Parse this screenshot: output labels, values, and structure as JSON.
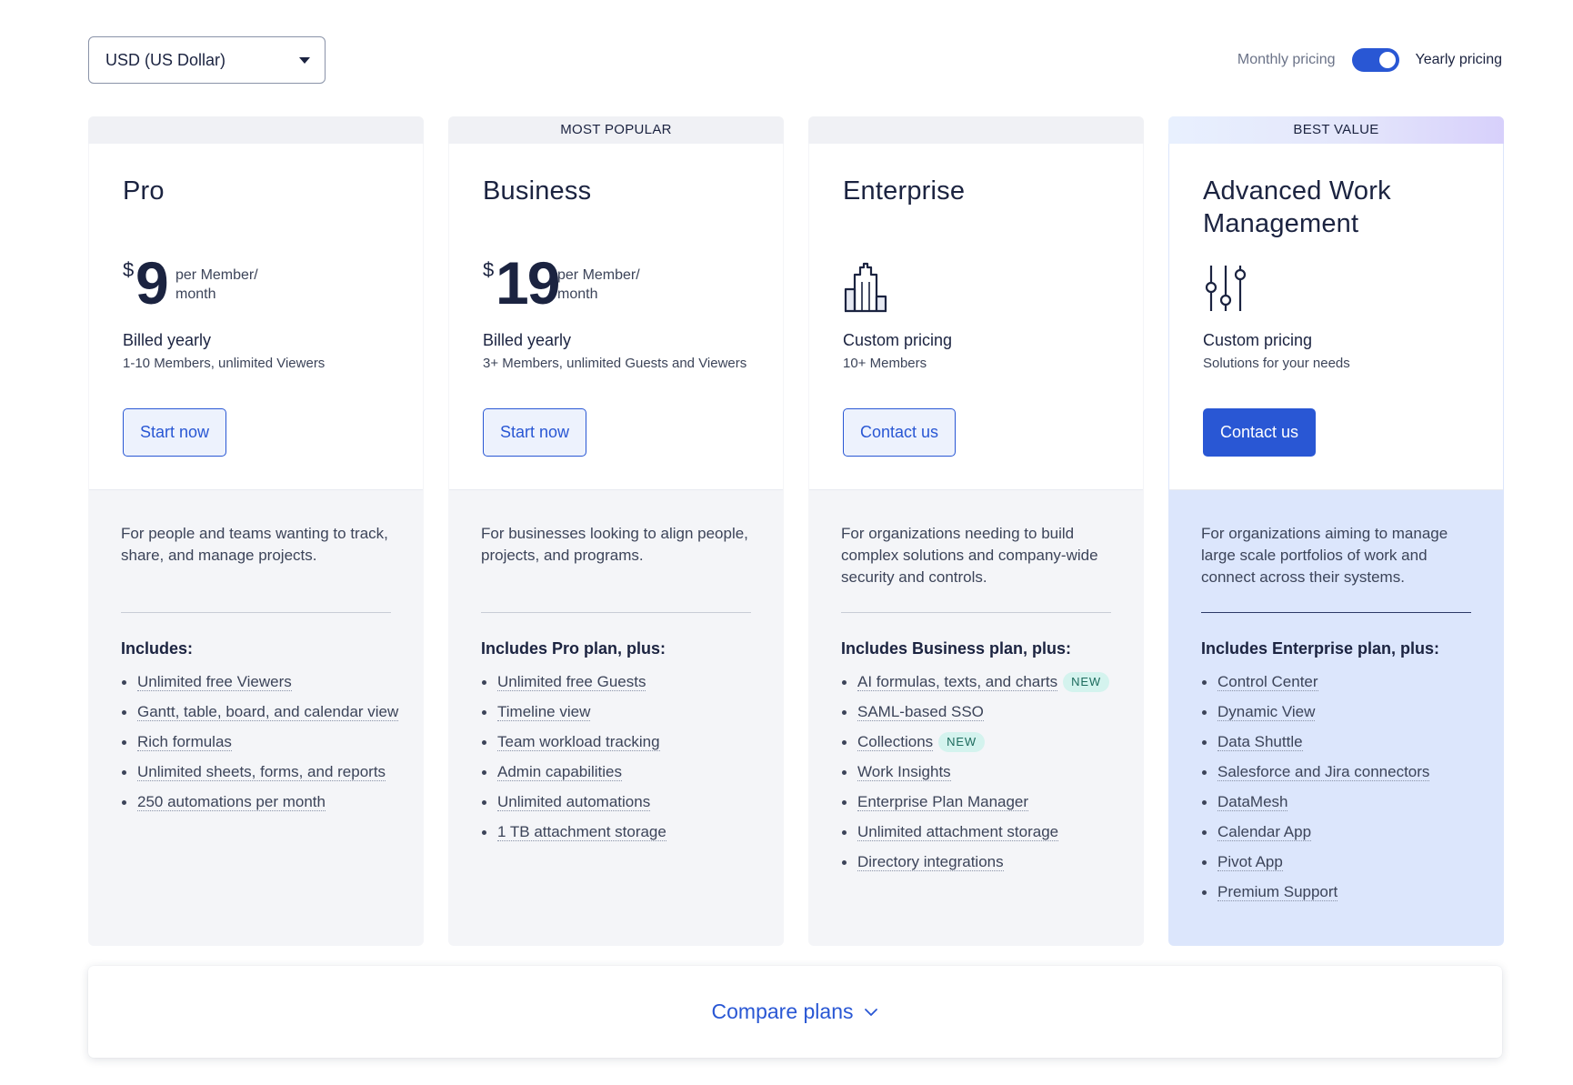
{
  "currency": {
    "selected": "USD (US Dollar)"
  },
  "toggle": {
    "monthly_label": "Monthly pricing",
    "yearly_label": "Yearly pricing",
    "selected": "yearly"
  },
  "plans": [
    {
      "banner": "",
      "name": "Pro",
      "price_currency": "$",
      "price_amount": "9",
      "price_per_line1": "per Member/",
      "price_per_line2": "month",
      "billing_title": "Billed yearly",
      "billing_sub": "1-10 Members, unlimited Viewers",
      "cta": "Start now",
      "description": "For people and teams wanting to track, share, and manage projects.",
      "includes_title": "Includes:",
      "features": [
        {
          "text": "Unlimited free Viewers"
        },
        {
          "text": "Gantt, table, board, and calendar view"
        },
        {
          "text": "Rich formulas"
        },
        {
          "text": "Unlimited sheets, forms, and reports"
        },
        {
          "text": "250 automations per month"
        }
      ]
    },
    {
      "banner": "MOST POPULAR",
      "name": "Business",
      "price_currency": "$",
      "price_amount": "19",
      "price_per_line1": "per Member/",
      "price_per_line2": "month",
      "billing_title": "Billed yearly",
      "billing_sub": "3+ Members, unlimited Guests and Viewers",
      "cta": "Start now",
      "description": "For businesses looking to align people, projects, and programs.",
      "includes_title": "Includes Pro plan, plus:",
      "features": [
        {
          "text": "Unlimited free Guests"
        },
        {
          "text": "Timeline view"
        },
        {
          "text": "Team workload tracking"
        },
        {
          "text": "Admin capabilities"
        },
        {
          "text": "Unlimited automations"
        },
        {
          "text": "1 TB attachment storage"
        }
      ]
    },
    {
      "banner": "",
      "name": "Enterprise",
      "icon": "building-icon",
      "billing_title": "Custom pricing",
      "billing_sub": "10+ Members",
      "cta": "Contact us",
      "description": "For organizations needing to build complex solutions and company-wide security and controls.",
      "includes_title": "Includes Business plan, plus:",
      "features": [
        {
          "text": "AI formulas, texts, and charts",
          "badge": "NEW"
        },
        {
          "text": "SAML-based SSO"
        },
        {
          "text": "Collections",
          "badge": "NEW"
        },
        {
          "text": "Work Insights"
        },
        {
          "text": "Enterprise Plan Manager"
        },
        {
          "text": "Unlimited attachment storage"
        },
        {
          "text": "Directory integrations"
        }
      ]
    },
    {
      "banner": "BEST VALUE",
      "name": "Advanced Work Management",
      "icon": "sliders-icon",
      "billing_title": "Custom pricing",
      "billing_sub": "Solutions for your needs",
      "cta": "Contact us",
      "description": "For organizations aiming to manage large scale portfolios of work and connect across their systems.",
      "includes_title": "Includes Enterprise plan, plus:",
      "features": [
        {
          "text": "Control Center"
        },
        {
          "text": "Dynamic View"
        },
        {
          "text": "Data Shuttle"
        },
        {
          "text": "Salesforce and Jira connectors"
        },
        {
          "text": "DataMesh"
        },
        {
          "text": "Calendar App"
        },
        {
          "text": "Pivot App"
        },
        {
          "text": "Premium Support"
        }
      ]
    }
  ],
  "compare": {
    "label": "Compare plans"
  },
  "colors": {
    "accent": "#2957d4",
    "featured_bg": "#dce6fc",
    "card_bg": "#f4f5f8",
    "badge_bg": "#d4f3ee"
  }
}
